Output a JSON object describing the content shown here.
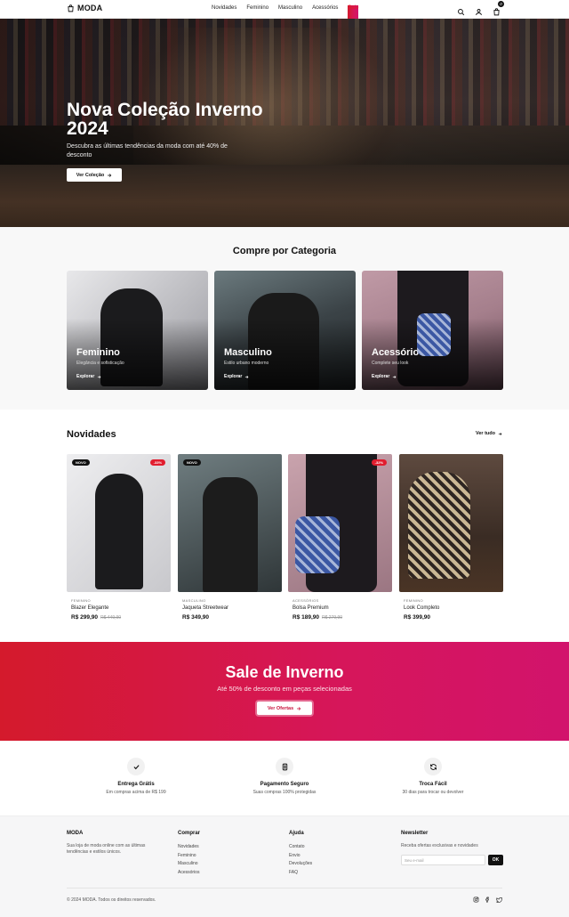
{
  "header": {
    "logo": "MODA",
    "nav": [
      "Novidades",
      "Feminino",
      "Masculino",
      "Acessórios",
      "Sale"
    ],
    "cart_count": "0"
  },
  "hero": {
    "title": "Nova Coleção Inverno 2024",
    "subtitle": "Descubra as últimas tendências da moda com até 40% de desconto",
    "cta": "Ver Coleção"
  },
  "categories": {
    "title": "Compre por Categoria",
    "items": [
      {
        "title": "Feminino",
        "subtitle": "Elegância e sofisticação",
        "link": "Explorar"
      },
      {
        "title": "Masculino",
        "subtitle": "Estilo urbano moderno",
        "link": "Explorar"
      },
      {
        "title": "Acessórios",
        "subtitle": "Complete seu look",
        "link": "Explorar"
      }
    ]
  },
  "new_arrivals": {
    "title": "Novidades",
    "see_all": "Ver tudo",
    "products": [
      {
        "badge": "NOVO",
        "discount": "-33%",
        "category": "FEMININO",
        "name": "Blazer Elegante",
        "price": "R$ 299,90",
        "old_price": "R$ 449,90"
      },
      {
        "badge": "NOVO",
        "discount": "",
        "category": "MASCULINO",
        "name": "Jaqueta Streetwear",
        "price": "R$ 349,90",
        "old_price": ""
      },
      {
        "badge": "",
        "discount": "-32%",
        "category": "ACESSÓRIOS",
        "name": "Bolsa Premium",
        "price": "R$ 189,90",
        "old_price": "R$ 279,90"
      },
      {
        "badge": "",
        "discount": "",
        "category": "FEMININO",
        "name": "Look Completo",
        "price": "R$ 399,90",
        "old_price": ""
      }
    ]
  },
  "sale": {
    "title": "Sale de Inverno",
    "subtitle": "Até 50% de desconto em peças selecionadas",
    "cta": "Ver Ofertas"
  },
  "features": [
    {
      "icon": "check-icon",
      "title": "Entrega Grátis",
      "desc": "Em compras acima de R$ 199"
    },
    {
      "icon": "card-icon",
      "title": "Pagamento Seguro",
      "desc": "Suas compras 100% protegidas"
    },
    {
      "icon": "refresh-icon",
      "title": "Troca Fácil",
      "desc": "30 dias para trocar ou devolver"
    }
  ],
  "footer": {
    "brand": "MODA",
    "brand_desc": "Sua loja de moda online com as últimas tendências e estilos únicos.",
    "shop_title": "Comprar",
    "shop_links": [
      "Novidades",
      "Feminino",
      "Masculino",
      "Acessórios"
    ],
    "help_title": "Ajuda",
    "help_links": [
      "Contato",
      "Envio",
      "Devoluções",
      "FAQ"
    ],
    "newsletter_title": "Newsletter",
    "newsletter_desc": "Receba ofertas exclusivas e novidades",
    "newsletter_placeholder": "Seu e-mail",
    "newsletter_button": "OK",
    "copyright": "© 2024 MODA. Todos os direitos reservados."
  }
}
